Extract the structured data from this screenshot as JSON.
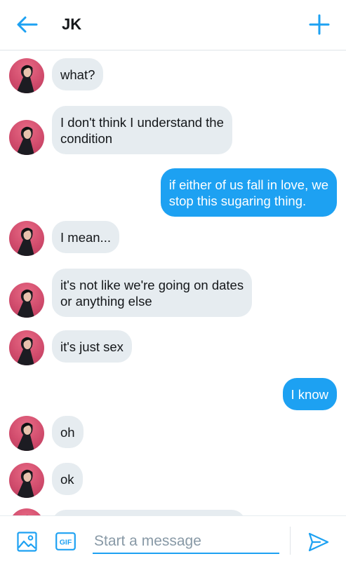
{
  "header": {
    "back_icon": "arrow-left-icon",
    "title": "JK",
    "new_icon": "plus-icon"
  },
  "colors": {
    "accent": "#1da1f2",
    "incoming_bubble": "#e6ecf0",
    "avatar_bg": "#cf4a6b"
  },
  "messages": [
    {
      "side": "in",
      "text": "what?"
    },
    {
      "side": "in",
      "text": "I don't think I understand the\ncondition"
    },
    {
      "side": "out",
      "text": "if either of us fall in love, we\nstop this sugaring thing."
    },
    {
      "side": "in",
      "text": "I mean..."
    },
    {
      "side": "in",
      "text": "it's not like we're going on dates\nor anything else"
    },
    {
      "side": "in",
      "text": "it's just sex"
    },
    {
      "side": "out",
      "text": "I know"
    },
    {
      "side": "in",
      "text": "oh"
    },
    {
      "side": "in",
      "text": "ok"
    }
  ],
  "composer": {
    "media_icon": "image-icon",
    "gif_icon": "gif-icon",
    "gif_label": "GIF",
    "placeholder": "Start a message",
    "send_icon": "send-icon"
  }
}
